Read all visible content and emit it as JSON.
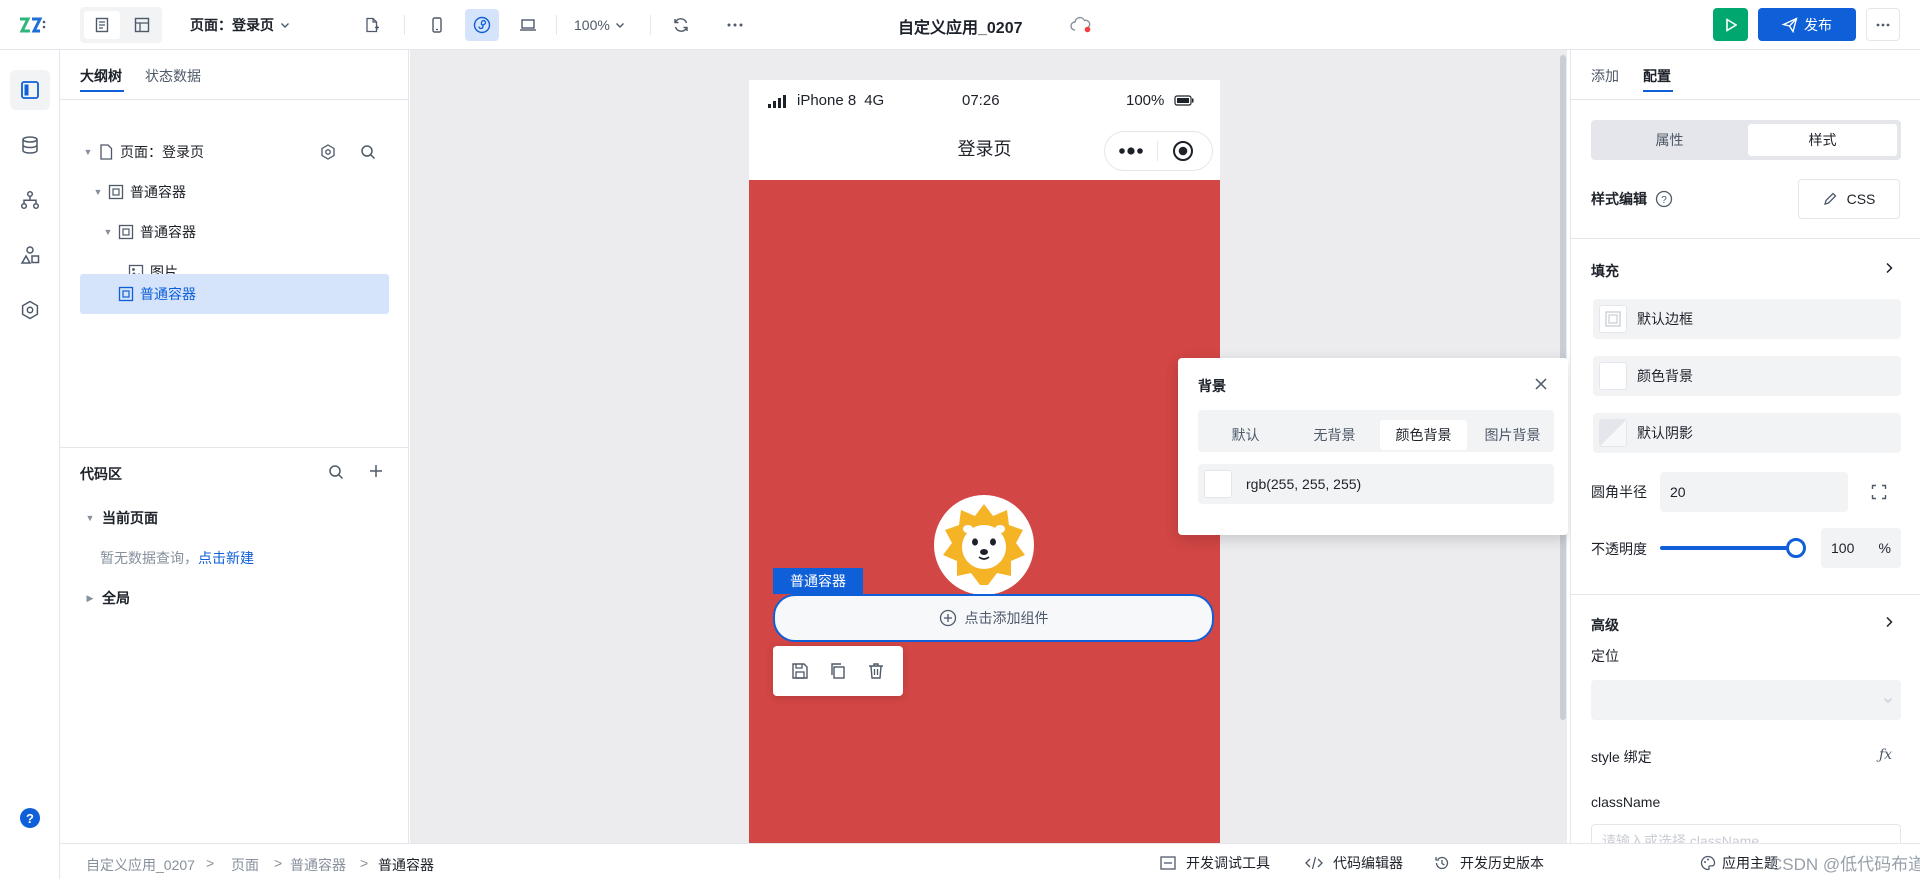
{
  "topbar": {
    "page_selector": "页面：登录页",
    "zoom": "100%",
    "app_title": "自定义应用_0207",
    "publish_label": "发布",
    "accent": "#0e5fd8",
    "run_color": "#00a870"
  },
  "left_panel": {
    "tabs": [
      "大纲树",
      "状态数据"
    ],
    "tree": [
      {
        "label": "页面：登录页"
      },
      {
        "label": "普通容器"
      },
      {
        "label": "普通容器"
      },
      {
        "label": "图片"
      },
      {
        "label": "普通容器"
      }
    ],
    "code": {
      "title": "代码区",
      "current_page": "当前页面",
      "empty_text": "暂无数据查询，",
      "create_link": "点击新建",
      "global": "全局"
    }
  },
  "phone": {
    "carrier": "iPhone 8",
    "network": "4G",
    "time": "07:26",
    "battery": "100%",
    "page_title": "登录页",
    "bg_color": "#d24645",
    "container_tag": "普通容器",
    "add_component": "点击添加组件"
  },
  "popover": {
    "title": "背景",
    "tabs": [
      "默认",
      "无背景",
      "颜色背景",
      "图片背景"
    ],
    "active_tab": 2,
    "color_value": "rgb(255, 255, 255)"
  },
  "right_panel": {
    "tabs": [
      "添加",
      "配置"
    ],
    "segment": [
      "属性",
      "样式"
    ],
    "style_edit": "样式编辑",
    "css_label": "CSS",
    "fill_title": "填充",
    "rows": [
      "默认边框",
      "颜色背景",
      "默认阴影"
    ],
    "radius_label": "圆角半径",
    "radius_value": "20",
    "opacity_label": "不透明度",
    "opacity_value": "100",
    "opacity_unit": "%",
    "opacity_level": 1.0,
    "advanced_title": "高级",
    "position_label": "定位",
    "style_binding": "style 绑定",
    "classname_label": "className",
    "classname_placeholder": "请输入或选择 className"
  },
  "status_bar": {
    "breadcrumb": [
      "自定义应用_0207",
      "页面",
      "普通容器",
      "普通容器"
    ],
    "debug_tools": "开发调试工具",
    "code_editor": "代码编辑器",
    "history": "开发历史版本",
    "theme": "应用主题",
    "watermark": "CSDN @低代码布道师"
  }
}
